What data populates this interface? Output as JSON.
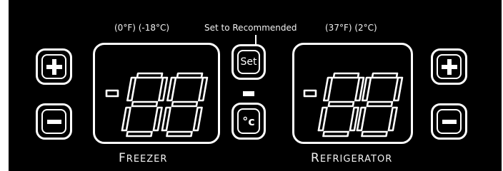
{
  "freezer": {
    "temp_label": "(0°F) (-18°C)",
    "display_value": "-88",
    "name_first": "F",
    "name_rest": "REEZER",
    "plus_icon": "plus-icon",
    "minus_icon": "minus-icon"
  },
  "set_hint": "Set to Recommended",
  "set_button_label": "Set",
  "unit_button_label": "°c",
  "refrigerator": {
    "temp_label": "(37°F) (2°C)",
    "display_value": "-88",
    "name_first": "R",
    "name_rest": "EFRIGERATOR",
    "plus_icon": "plus-icon",
    "minus_icon": "minus-icon"
  },
  "colors": {
    "panel": "#000000",
    "foreground": "#ffffff"
  }
}
